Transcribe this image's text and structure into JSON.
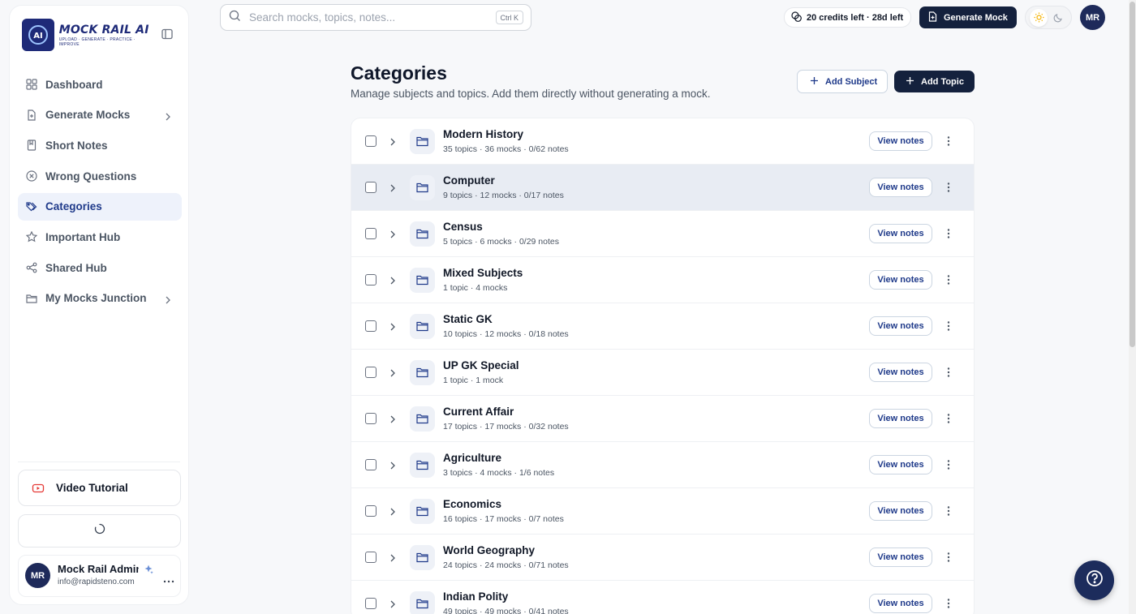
{
  "brand": {
    "name": "MOCK RAIL AI",
    "tagline": "UPLOAD · GENERATE · PRACTICE · IMPROVE"
  },
  "sidebar": {
    "items": [
      {
        "label": "Dashboard",
        "icon": "grid-icon"
      },
      {
        "label": "Generate Mocks",
        "icon": "file-icon",
        "has_submenu": true
      },
      {
        "label": "Short Notes",
        "icon": "notebook-icon"
      },
      {
        "label": "Wrong Questions",
        "icon": "x-circle-icon"
      },
      {
        "label": "Categories",
        "icon": "tags-icon",
        "active": true
      },
      {
        "label": "Important Hub",
        "icon": "star-icon"
      },
      {
        "label": "Shared Hub",
        "icon": "share-icon"
      },
      {
        "label": "My Mocks Junction",
        "icon": "folder-icon",
        "has_submenu": true
      }
    ],
    "video_tutorial": "Video Tutorial",
    "user": {
      "initials": "MR",
      "name": "Mock Rail Admin",
      "email": "info@rapidsteno.com"
    }
  },
  "topbar": {
    "search_placeholder": "Search mocks, topics, notes...",
    "search_shortcut": "Ctrl K",
    "credits": "20 credits left · 28d left",
    "generate_mock": "Generate Mock",
    "avatar_initials": "MR"
  },
  "header": {
    "title": "Categories",
    "subtitle": "Manage subjects and topics. Add them directly without generating a mock.",
    "add_subject": "Add Subject",
    "add_topic": "Add Topic"
  },
  "view_notes_label": "View notes",
  "categories": [
    {
      "name": "Modern History",
      "meta": "35 topics · 36 mocks · 0/62 notes"
    },
    {
      "name": "Computer",
      "meta": "9 topics · 12 mocks · 0/17 notes",
      "highlighted": true
    },
    {
      "name": "Census",
      "meta": "5 topics · 6 mocks · 0/29 notes"
    },
    {
      "name": "Mixed Subjects",
      "meta": "1 topic · 4 mocks"
    },
    {
      "name": "Static GK",
      "meta": "10 topics · 12 mocks · 0/18 notes"
    },
    {
      "name": "UP GK Special",
      "meta": "1 topic · 1 mock"
    },
    {
      "name": "Current Affair",
      "meta": "17 topics · 17 mocks · 0/32 notes"
    },
    {
      "name": "Agriculture",
      "meta": "3 topics · 4 mocks · 1/6 notes"
    },
    {
      "name": "Economics",
      "meta": "16 topics · 17 mocks · 0/7 notes"
    },
    {
      "name": "World Geography",
      "meta": "24 topics · 24 mocks · 0/71 notes"
    },
    {
      "name": "Indian Polity",
      "meta": "49 topics · 49 mocks · 0/41 notes"
    }
  ],
  "colors": {
    "primary": "#14213d",
    "accent": "#1f3a8a",
    "active_bg": "#eef2fb",
    "row_highlight": "#e8ecf3"
  }
}
